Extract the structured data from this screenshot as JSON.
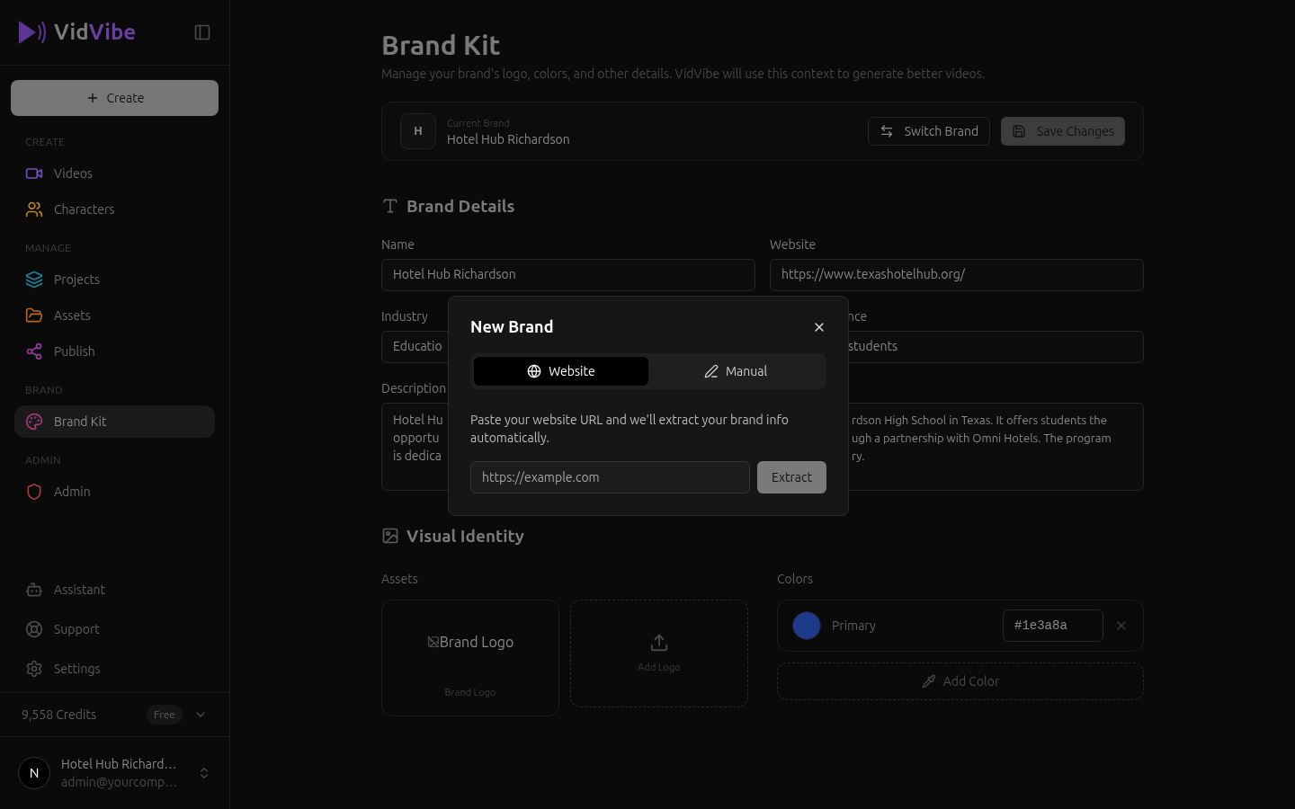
{
  "app": {
    "logo_prefix": "Vid",
    "logo_suffix": "Vibe",
    "create_button": "Create"
  },
  "nav_sections": [
    {
      "heading": "CREATE",
      "items": [
        {
          "label": "Videos",
          "color": "#6d4fc0",
          "selected": false
        },
        {
          "label": "Characters",
          "color": "#b8861a",
          "selected": false
        }
      ]
    },
    {
      "heading": "MANAGE",
      "items": [
        {
          "label": "Projects",
          "color": "#1a8599",
          "selected": false
        },
        {
          "label": "Assets",
          "color": "#b8651a",
          "selected": false
        },
        {
          "label": "Publish",
          "color": "#953a9c",
          "selected": false
        }
      ]
    },
    {
      "heading": "BRAND",
      "items": [
        {
          "label": "Brand Kit",
          "color": "#a83a78",
          "selected": true
        }
      ]
    },
    {
      "heading": "ADMIN",
      "items": [
        {
          "label": "Admin",
          "color": "#a83a3a",
          "selected": false
        }
      ]
    }
  ],
  "footer_links": [
    "Assistant",
    "Support",
    "Settings"
  ],
  "credits": {
    "label": "9,558 Credits",
    "plan": "Free"
  },
  "account": {
    "avatar": "N",
    "name": "Hotel Hub Richard…",
    "email": "admin@yourcomp…"
  },
  "page": {
    "title": "Brand Kit",
    "subtitle": "Manage your brand's logo, colors, and other details. VidVibe will use this context to generate better videos."
  },
  "brand_bar": {
    "initial": "H",
    "caption": "Current Brand",
    "name": "Hotel Hub Richardson",
    "switch_button": "Switch Brand",
    "save_button": "Save Changes"
  },
  "brand_details": {
    "title": "Brand Details",
    "name": {
      "label": "Name",
      "value": "Hotel Hub Richardson"
    },
    "website": {
      "label": "Website",
      "value": "https://www.texashotelhub.org/"
    },
    "industry": {
      "label": "Industry",
      "value": "Educatio"
    },
    "audience": {
      "label": "nce",
      "value": "students"
    },
    "description": {
      "label": "Description",
      "left_lines": [
        "Hotel Hu",
        "opportu",
        "is dedica"
      ],
      "right_lines": [
        "rdson High School in Texas. It offers students the",
        "ugh a partnership with Omni Hotels. The program",
        "ry."
      ]
    }
  },
  "visual_identity": {
    "title": "Visual Identity",
    "assets_label": "Assets",
    "logo_alt": "Brand Logo",
    "logo_caption": "Brand Logo",
    "add_logo": "Add Logo",
    "colors_label": "Colors",
    "colors": [
      {
        "name": "Primary",
        "value": "#1e3a8a",
        "color": "#1e3a8a"
      }
    ],
    "add_color": "Add Color"
  },
  "dialog": {
    "title": "New Brand",
    "tabs": [
      {
        "label": "Website",
        "selected": true
      },
      {
        "label": "Manual",
        "selected": false
      }
    ],
    "text": "Paste your website URL and we'll extract your brand info automatically.",
    "placeholder": "https://example.com",
    "button": "Extract"
  }
}
